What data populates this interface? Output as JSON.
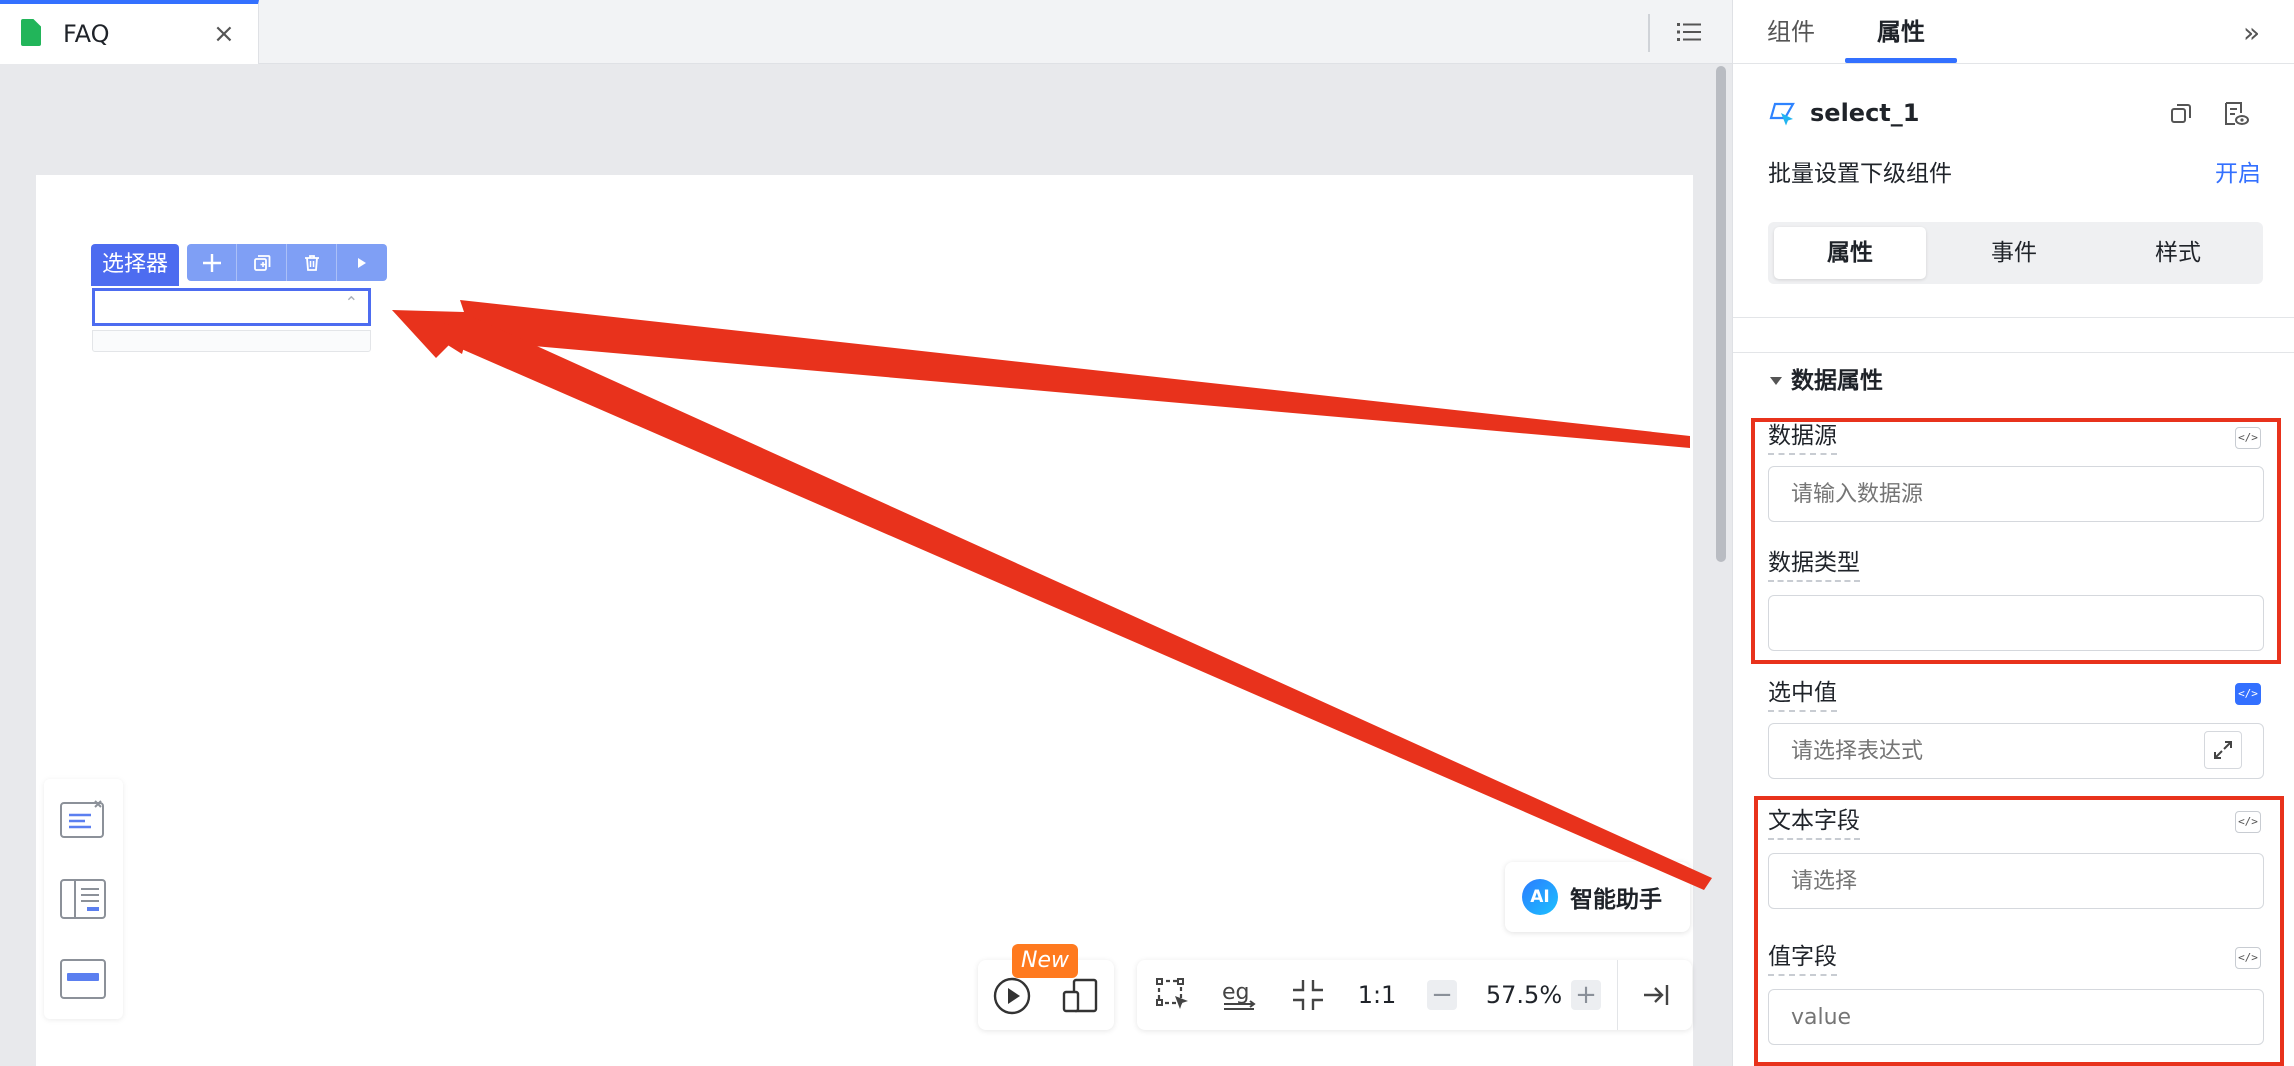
{
  "editor": {
    "tab_title": "FAQ",
    "tab_close": "×",
    "component_label": "选择器"
  },
  "ai_assistant": {
    "logo": "AI",
    "label": "智能助手"
  },
  "preview": {
    "badge": "New"
  },
  "zoom": {
    "ratio_label": "1:1",
    "minus": "−",
    "plus": "+",
    "value": "57.5%"
  },
  "panel": {
    "tabs": [
      "组件",
      "属性"
    ],
    "active_tab": "属性",
    "collapse": "»",
    "component_name": "select_1",
    "batch_label": "批量设置下级组件",
    "batch_toggle": "开启",
    "segments": [
      "属性",
      "事件",
      "样式"
    ],
    "active_segment": "属性",
    "section_title": "数据属性",
    "code_toggle": "</>",
    "fields": {
      "datasource": {
        "label": "数据源",
        "placeholder": "请输入数据源"
      },
      "datatype": {
        "label": "数据类型",
        "placeholder": ""
      },
      "selected": {
        "label": "选中值",
        "placeholder": "请选择表达式"
      },
      "textfield": {
        "label": "文本字段",
        "placeholder": "请选择"
      },
      "valuefield": {
        "label": "值字段",
        "placeholder": "value"
      }
    }
  },
  "colors": {
    "accent": "#3370ff",
    "annotation_red": "#e8321c",
    "selection_blue": "#4d6cf0",
    "new_badge": "#ff7a1f"
  }
}
